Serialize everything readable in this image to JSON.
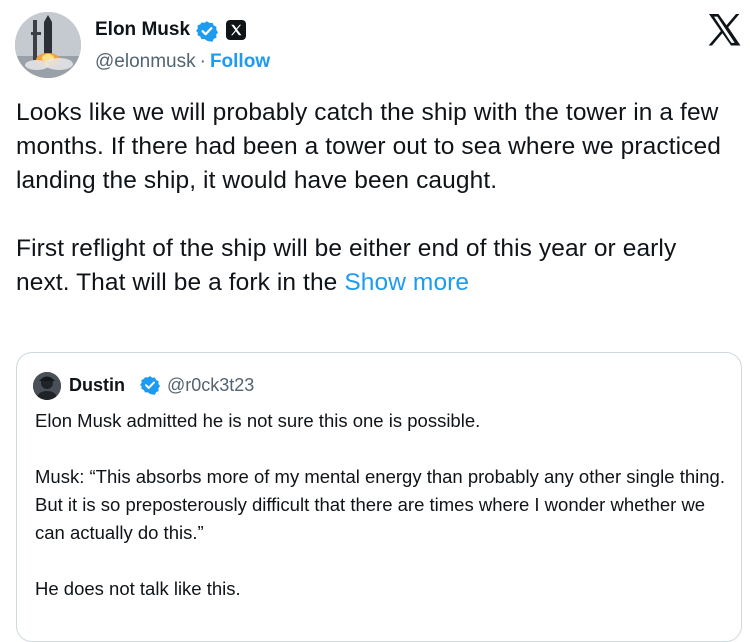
{
  "author": {
    "name": "Elon Musk",
    "handle": "@elonmusk",
    "separator": "·",
    "follow_label": "Follow",
    "avatar_icon": "rocket-launch-avatar",
    "verified_icon": "verified-badge-icon",
    "affiliation_icon": "x-affiliation-icon"
  },
  "platform": {
    "logo_icon": "x-logo-icon"
  },
  "tweet": {
    "paragraph_1": "Looks like we will probably catch the ship with the tower in a few months. If there had been a tower out to sea where we practiced landing the ship, it would have been caught.",
    "paragraph_2": "First reflight of the ship will be either end of this year or early next. That will be a fork in the",
    "show_more_label": "Show more"
  },
  "quoted_tweet": {
    "author_name": "Dustin",
    "author_handle": "@r0ck3t23",
    "avatar_icon": "user-avatar",
    "verified_icon": "verified-badge-icon",
    "paragraph_1": "Elon Musk admitted he is not sure this one is possible.",
    "paragraph_2": "Musk: “This absorbs more of my mental energy than probably any other single thing. But it is so preposterously difficult that there are times where I wonder whether we can actually do this.”",
    "paragraph_3": "He does not talk like this."
  },
  "colors": {
    "link_blue": "#1d9bf0",
    "text_primary": "#0f1419",
    "text_secondary": "#536471",
    "border": "#cfd9de"
  }
}
